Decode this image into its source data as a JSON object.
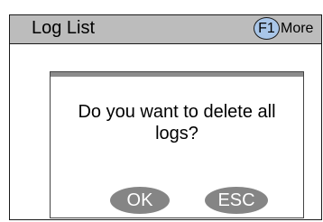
{
  "titlebar": {
    "title": "Log List",
    "f1_key": "F1",
    "more_label": "More"
  },
  "dialog": {
    "message": "Do you want to delete all logs?",
    "ok_label": "OK",
    "esc_label": "ESC"
  },
  "colors": {
    "titlebar_bg": "#bcbcbc",
    "key_badge": "#a9c6e8",
    "button_bg": "#858585"
  }
}
